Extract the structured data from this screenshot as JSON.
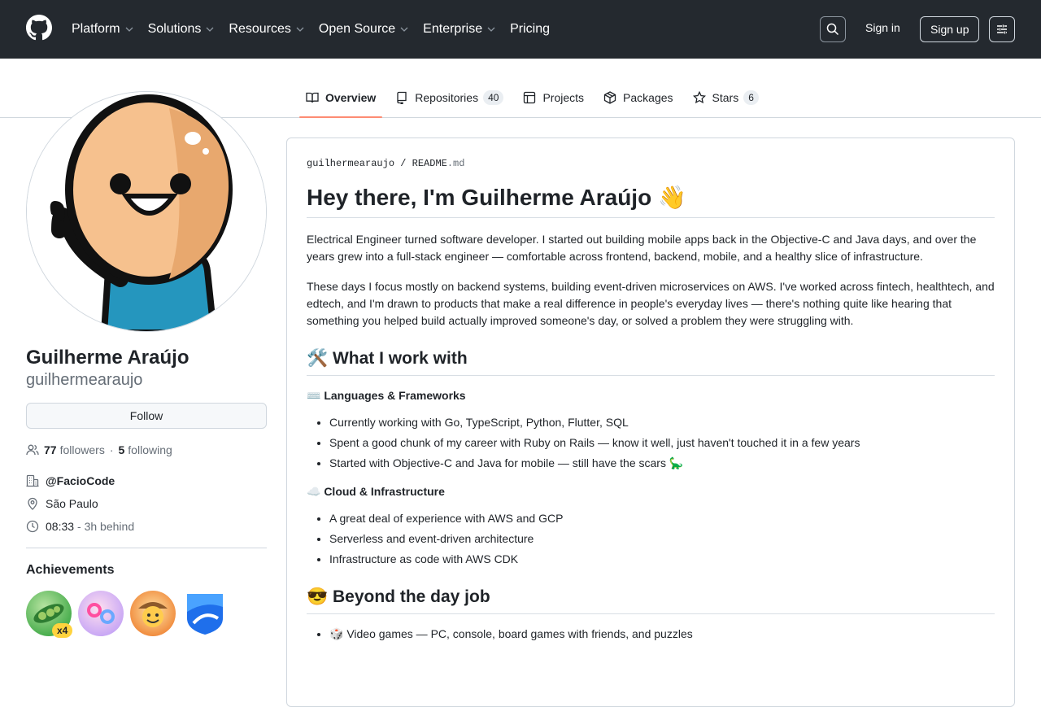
{
  "header": {
    "nav": [
      {
        "label": "Platform",
        "has_menu": true
      },
      {
        "label": "Solutions",
        "has_menu": true
      },
      {
        "label": "Resources",
        "has_menu": true
      },
      {
        "label": "Open Source",
        "has_menu": true
      },
      {
        "label": "Enterprise",
        "has_menu": true
      },
      {
        "label": "Pricing",
        "has_menu": false
      }
    ],
    "sign_in": "Sign in",
    "sign_up": "Sign up"
  },
  "tabs": [
    {
      "label": "Overview",
      "icon": "book-icon",
      "active": true
    },
    {
      "label": "Repositories",
      "icon": "repo-icon",
      "count": "40"
    },
    {
      "label": "Projects",
      "icon": "table-icon"
    },
    {
      "label": "Packages",
      "icon": "package-icon"
    },
    {
      "label": "Stars",
      "icon": "star-icon",
      "count": "6"
    }
  ],
  "profile": {
    "name": "Guilherme Araújo",
    "login": "guilhermearaujo",
    "follow_label": "Follow",
    "followers_count": "77",
    "followers_label": "followers",
    "separator": "·",
    "following_count": "5",
    "following_label": "following",
    "organization": "@FacioCode",
    "location": "São Paulo",
    "local_time": "08:33",
    "time_offset": "- 3h behind",
    "achievements_title": "Achievements",
    "achievement_count": "x4"
  },
  "readme": {
    "path_user": "guilhermearaujo",
    "path_sep": "/",
    "path_file": "README",
    "path_ext": ".md",
    "title": "Hey there, I'm Guilherme Araújo 👋",
    "p1": "Electrical Engineer turned software developer. I started out building mobile apps back in the Objective-C and Java days, and over the years grew into a full-stack engineer — comfortable across frontend, backend, mobile, and a healthy slice of infrastructure.",
    "p2": "These days I focus mostly on backend systems, building event-driven microservices on AWS. I've worked across fintech, healthtech, and edtech, and I'm drawn to products that make a real difference in people's everyday lives — there's nothing quite like hearing that something you helped build actually improved someone's day, or solved a problem they were struggling with.",
    "h2_work": "🛠️ What I work with",
    "sub_lang": "⌨️ Languages & Frameworks",
    "lang_items": [
      "Currently working with Go, TypeScript, Python, Flutter, SQL",
      "Spent a good chunk of my career with Ruby on Rails — know it well, just haven't touched it in a few years",
      "Started with Objective-C and Java for mobile — still have the scars 🦕"
    ],
    "sub_cloud": "☁️ Cloud & Infrastructure",
    "cloud_items": [
      "A great deal of experience with AWS and GCP",
      "Serverless and event-driven architecture",
      "Infrastructure as code with AWS CDK"
    ],
    "h2_beyond": "😎 Beyond the day job",
    "beyond_items": [
      "🎲 Video games — PC, console, board games with friends, and puzzles"
    ]
  }
}
